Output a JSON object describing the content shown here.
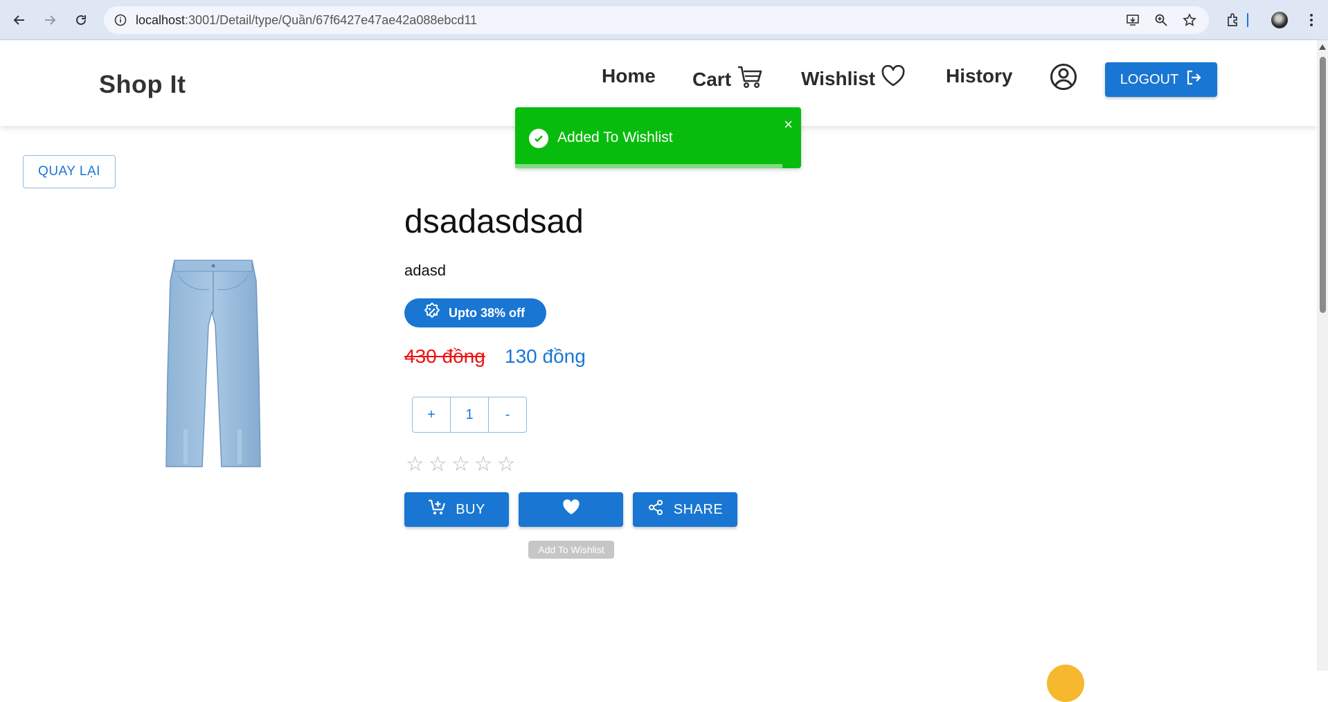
{
  "browser": {
    "url_host": "localhost",
    "url_rest": ":3001/Detail/type/Quần/67f6427e47ae42a088ebcd11"
  },
  "header": {
    "logo": "Shop It",
    "nav": {
      "home": "Home",
      "cart": "Cart",
      "wishlist": "Wishlist",
      "history": "History"
    },
    "logout": "LOGOUT"
  },
  "toast": {
    "message": "Added To Wishlist",
    "close": "×",
    "color": "#08bc0e"
  },
  "page": {
    "back_button": "QUAY LẠI",
    "product": {
      "title": "dsadasdsad",
      "description": "adasd",
      "discount_badge": "Upto 38% off",
      "old_price": "430 đồng",
      "new_price": "130 đồng",
      "quantity": "1",
      "plus": "+",
      "minus": "-",
      "rating": 0,
      "stars": [
        "☆",
        "☆",
        "☆",
        "☆",
        "☆"
      ]
    },
    "actions": {
      "buy": "BUY",
      "share": "SHARE",
      "wishlist_tooltip": "Add To Wishlist"
    }
  },
  "colors": {
    "primary": "#1976d2",
    "old_price": "#ee1111"
  }
}
